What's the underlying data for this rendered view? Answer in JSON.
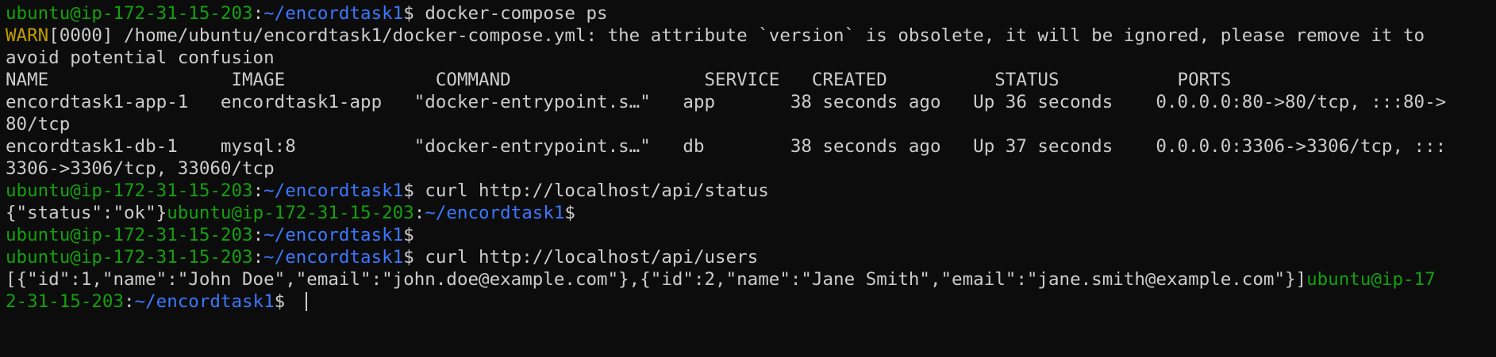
{
  "prompt": {
    "user_host": "ubuntu@ip-172-31-15-203",
    "separator": ":",
    "path": "~/encordtask1",
    "symbol": "$ "
  },
  "commands": {
    "cmd1": "docker-compose ps",
    "cmd2": "curl http://localhost/api/status",
    "cmd3": "curl http://localhost/api/users"
  },
  "output": {
    "warn_label": "WARN",
    "warn_line1": "[0000] /home/ubuntu/encordtask1/docker-compose.yml: the attribute `version` is obsolete, it will be ignored, please remove it to",
    "warn_line2": "avoid potential confusion",
    "table_header": "NAME                 IMAGE              COMMAND                  SERVICE   CREATED          STATUS           PORTS",
    "row1_line1": "encordtask1-app-1   encordtask1-app   \"docker-entrypoint.s…\"   app       38 seconds ago   Up 36 seconds    0.0.0.0:80->80/tcp, :::80->",
    "row1_line2": "80/tcp",
    "row2_line1": "encordtask1-db-1    mysql:8           \"docker-entrypoint.s…\"   db        38 seconds ago   Up 37 seconds    0.0.0.0:3306->3306/tcp, :::",
    "row2_line2": "3306->3306/tcp, 33060/tcp",
    "status_response": "{\"status\":\"ok\"}",
    "users_response": "[{\"id\":1,\"name\":\"John Doe\",\"email\":\"john.doe@example.com\"},{\"id\":2,\"name\":\"Jane Smith\",\"email\":\"jane.smith@example.com\"}]",
    "wrapped_user_part1": "ubuntu@ip-17",
    "wrapped_user_part2": "2-31-15-203"
  },
  "colors": {
    "background": "#0c0c0c",
    "text": "#cccccc",
    "user_host": "#13a10e",
    "path": "#3b78ff",
    "warn": "#c19c00"
  }
}
